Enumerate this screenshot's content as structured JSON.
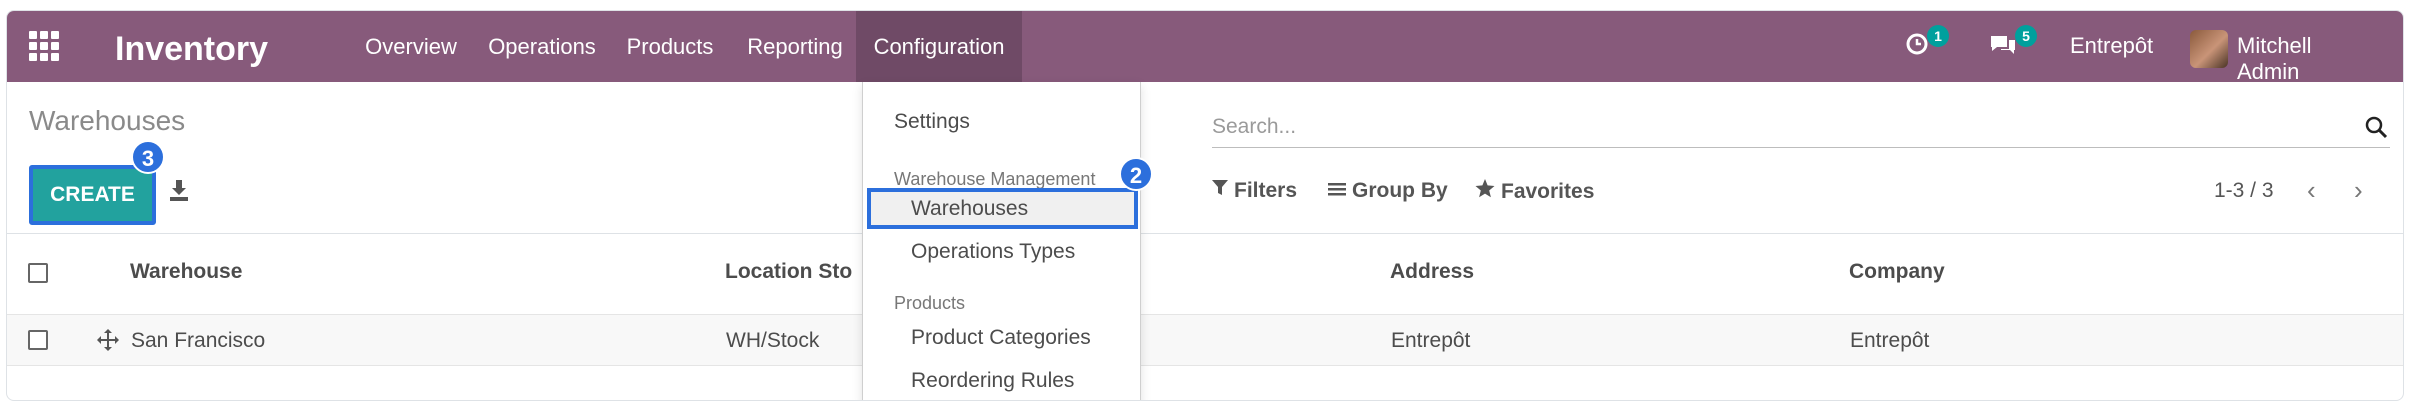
{
  "navbar": {
    "brand": "Inventory",
    "menu": [
      "Overview",
      "Operations",
      "Products",
      "Reporting",
      "Configuration"
    ],
    "activity_count": "1",
    "messages_count": "5",
    "company": "Entrepôt",
    "user": "Mitchell Admin"
  },
  "control_panel": {
    "title": "Warehouses",
    "create_label": "CREATE",
    "create_step": "3",
    "search_placeholder": "Search...",
    "filters_label": "Filters",
    "group_by_label": "Group By",
    "favorites_label": "Favorites",
    "pager": "1-3 / 3"
  },
  "dropdown": {
    "settings": "Settings",
    "section_warehouse": "Warehouse Management",
    "warehouses": "Warehouses",
    "warehouses_step": "2",
    "operations_types": "Operations Types",
    "section_products": "Products",
    "product_categories": "Product Categories",
    "reordering_rules": "Reordering Rules"
  },
  "table": {
    "headers": [
      "Warehouse",
      "Location Sto",
      "Address",
      "Company"
    ],
    "rows": [
      {
        "warehouse": "San Francisco",
        "location": "WH/Stock",
        "address": "Entrepôt",
        "company": "Entrepôt"
      }
    ]
  },
  "colors": {
    "navbar": "#875a7b",
    "create_button": "#22a29e",
    "highlight": "#2c6fdc",
    "badge": "#00a09d"
  }
}
